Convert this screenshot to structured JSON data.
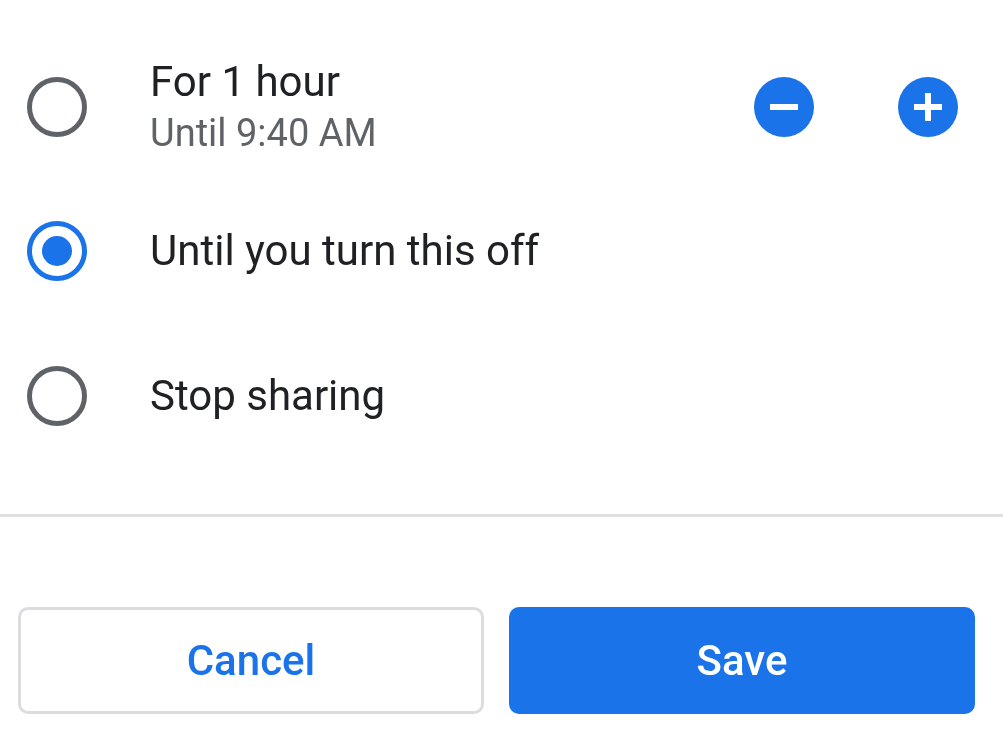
{
  "options": [
    {
      "kind": "timed",
      "label": "For 1 hour",
      "sublabel": "Until 9:40 AM",
      "selected": false
    },
    {
      "kind": "plain",
      "label": "Until you turn this off",
      "selected": true
    },
    {
      "kind": "plain",
      "label": "Stop sharing",
      "selected": false
    }
  ],
  "buttons": [
    {
      "kind": "secondary",
      "label": "Cancel"
    },
    {
      "kind": "primary",
      "label": "Save"
    }
  ]
}
